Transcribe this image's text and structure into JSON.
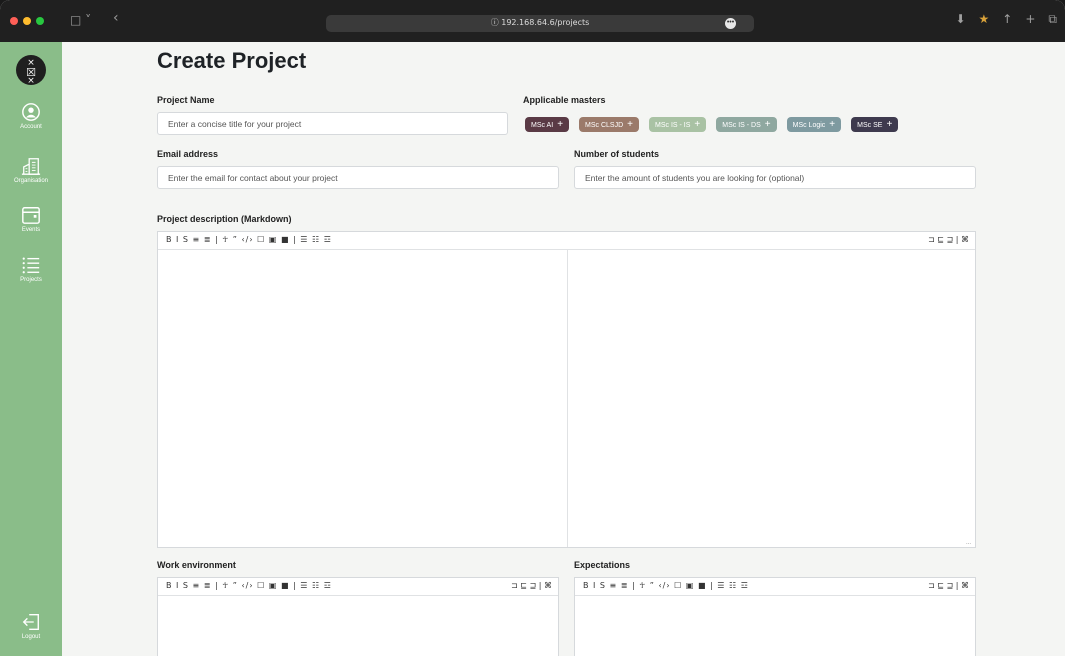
{
  "browser": {
    "url": "192.168.64.6/projects",
    "lock_glyph": "ⓘ",
    "sidebar_toggle_glyph": "□ ˅",
    "back_glyph": "‹",
    "url_more_glyph": "•••",
    "right_icons": [
      "download-icon",
      "extension-icon",
      "share-icon",
      "new-tab-icon",
      "tabs-overview-icon"
    ],
    "right_glyphs": [
      "⬇",
      "★",
      "↑",
      "+",
      "⧉"
    ]
  },
  "sidebar": {
    "logo_text": "×\n☒\n×",
    "items": [
      {
        "label": "Account",
        "icon": "account-icon"
      },
      {
        "label": "Organisation",
        "icon": "organisation-icon"
      },
      {
        "label": "Events",
        "icon": "calendar-icon"
      },
      {
        "label": "Projects",
        "icon": "list-icon"
      }
    ],
    "logout_label": "Logout"
  },
  "form": {
    "title": "Create Project",
    "project_name": {
      "label": "Project Name",
      "placeholder": "Enter a concise title for your project"
    },
    "masters": {
      "label": "Applicable masters",
      "chips": [
        {
          "label": "MSc AI",
          "color": "#5a3a45"
        },
        {
          "label": "MSc CLSJD",
          "color": "#9b7a6a"
        },
        {
          "label": "MSc IS - IS",
          "color": "#a9c2a4"
        },
        {
          "label": "MSc IS - DS",
          "color": "#8fa8a0"
        },
        {
          "label": "MSc Logic",
          "color": "#7e9aa0"
        },
        {
          "label": "MSc SE",
          "color": "#3e3a4e"
        }
      ]
    },
    "email": {
      "label": "Email address",
      "placeholder": "Enter the email for contact about your project"
    },
    "students": {
      "label": "Number of students",
      "placeholder": "Enter the amount of students you are looking for (optional)"
    },
    "description": {
      "label": "Project description (Markdown)"
    },
    "work_env": {
      "label": "Work environment"
    },
    "expectations": {
      "label": "Expectations"
    },
    "toolbar_left": "B I S ≡ ≣ | ☥ ” ‹/› ☐ ▣ ■ | ☰ ☷ ☲",
    "toolbar_right": "⊐ ⊑ ⊒ | ⌘",
    "resize_glyph": "..."
  }
}
